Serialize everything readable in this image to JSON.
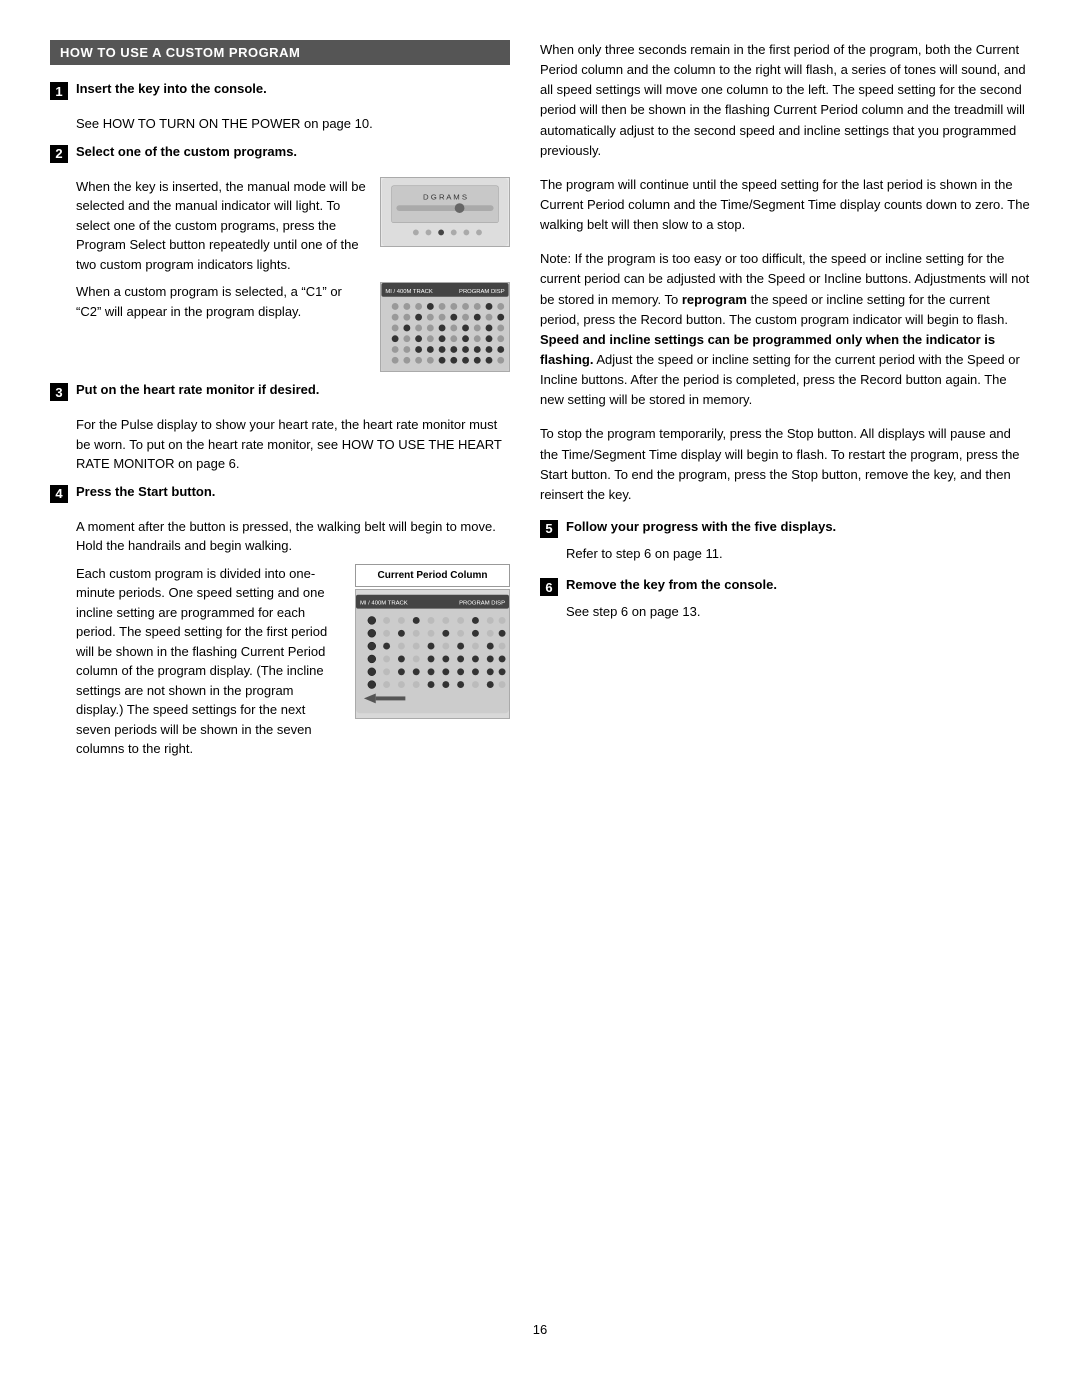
{
  "page": {
    "number": "16"
  },
  "header": {
    "title": "HOW TO USE A CUSTOM PROGRAM"
  },
  "steps_left": [
    {
      "num": "1",
      "title": "Insert the key into the console.",
      "body": "See HOW TO TURN ON THE POWER on page 10.",
      "has_image": false
    },
    {
      "num": "2",
      "title": "Select one of the custom programs.",
      "inline_text": "When the key is inserted, the manual mode will be selected and the manual indicator will light. To select one of the custom programs, press the Program Select button repeatedly until one of the two custom program indicators lights.",
      "below_text": "When a custom program is selected, a “C1” or “C2” will appear in the program display.",
      "has_image": true
    },
    {
      "num": "3",
      "title": "Put on the heart rate monitor if desired.",
      "body": "For the Pulse display to show your heart rate, the heart rate monitor must be worn. To put on the heart rate monitor, see HOW TO USE THE HEART RATE MONITOR on page 6.",
      "has_image": false
    },
    {
      "num": "4",
      "title": "Press the Start button.",
      "body": "A moment after the button is pressed, the walking belt will begin to move. Hold the handrails and begin walking.",
      "custom_program_text": "Each custom program is divided into one-minute periods. One speed setting and one incline setting are programmed for each period. The speed setting for the first period will be shown in the flashing Current Period column of the program display. (The incline settings are not shown in the program display.) The speed settings for the next seven periods will be shown in the seven columns to the right.",
      "current_period_label": "Current Period Column",
      "has_image": true
    }
  ],
  "right_col_paragraphs": [
    "When only three seconds remain in the first period of the program, both the Current Period column and the column to the right will flash, a series of tones will sound, and all speed settings will move one column to the left. The speed setting for the second period will then be shown in the flashing Current Period column and the treadmill will automatically adjust to the second speed and incline settings that you programmed previously.",
    "The program will continue until the speed setting for the last period is shown in the Current Period column and the Time/Segment Time display counts down to zero. The walking belt will then slow to a stop.",
    "Note: If the program is too easy or too difficult, the speed or incline setting for the current period can be adjusted with the Speed or Incline buttons. Adjustments will not be stored in memory. To reprogram the speed or incline setting for the current period, press the Record button. The custom program indicator will begin to flash. Speed and incline settings can be programmed only when the indicator is flashing. Adjust the speed or incline setting for the current period with the Speed or Incline buttons. After the period is completed, press the Record button again. The new setting will be stored in memory.",
    "To stop the program temporarily, press the Stop button. All displays will pause and the Time/Segment Time display will begin to flash. To restart the program, press the Start button. To end the program, press the Stop button, remove the key, and then reinsert the key."
  ],
  "steps_right": [
    {
      "num": "5",
      "title": "Follow your progress with the five displays.",
      "body": "Refer to step 6 on page 11."
    },
    {
      "num": "6",
      "title": "Remove the key from the console.",
      "body": "See step 6 on page 13."
    }
  ],
  "console1": {
    "label": "D G R A M S"
  },
  "console2": {
    "header_left": "MI / 400M TRACK",
    "header_right": "PROGRAM DISP"
  },
  "console3": {
    "header_left": "MI / 400M TRACK",
    "header_right": "PROGRAM DISP"
  }
}
